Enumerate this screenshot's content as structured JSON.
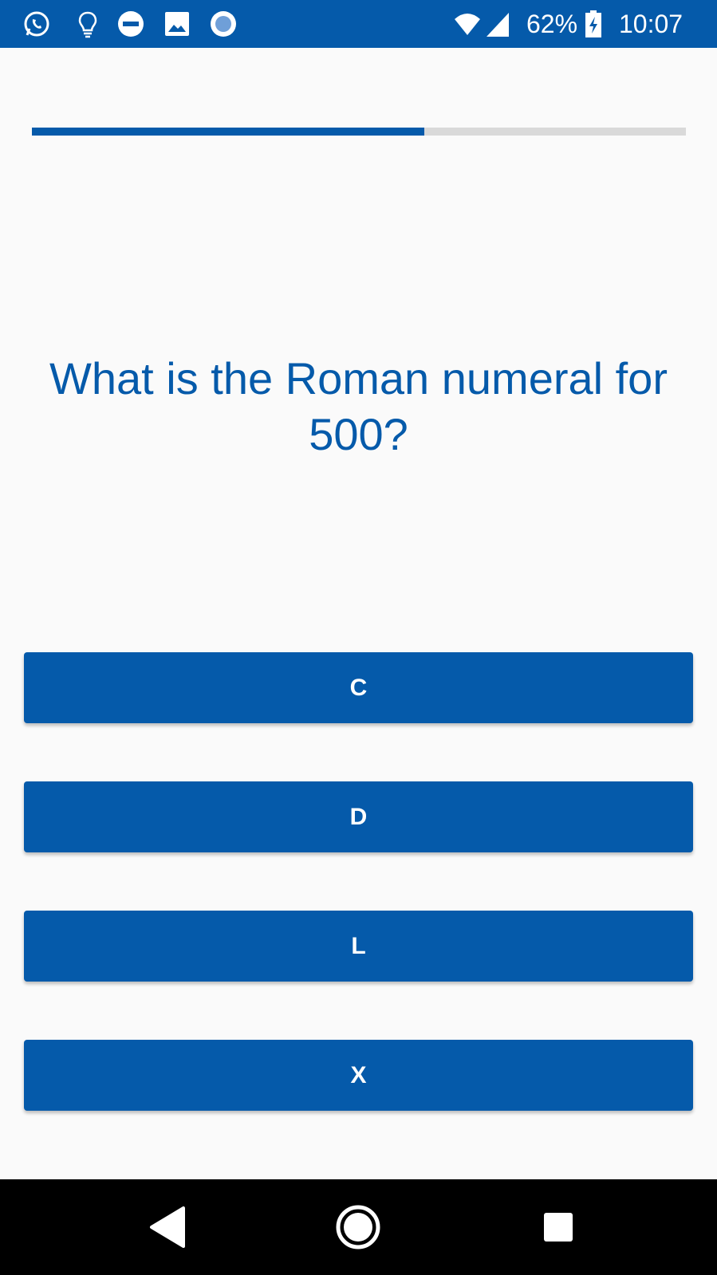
{
  "status_bar": {
    "background": "#055aaa",
    "left_icons": [
      "whatsapp-icon",
      "lightbulb-icon",
      "do-not-disturb-icon",
      "image-icon",
      "record-icon"
    ],
    "right_icons": [
      "wifi-icon",
      "cellular-signal-icon",
      "battery-charging-icon"
    ],
    "battery_percent": "62%",
    "time": "10:07"
  },
  "progress": {
    "fraction": 0.6,
    "fill_color": "#055aaa",
    "track_color": "#d9d9d9"
  },
  "question": {
    "text": "What is the Roman numeral for 500?",
    "color": "#055aaa"
  },
  "answers": [
    {
      "label": "C"
    },
    {
      "label": "D"
    },
    {
      "label": "L"
    },
    {
      "label": "X"
    }
  ],
  "answer_color": "#055aaa",
  "nav_bar": {
    "buttons": [
      "back-icon",
      "home-icon",
      "recents-icon"
    ]
  }
}
